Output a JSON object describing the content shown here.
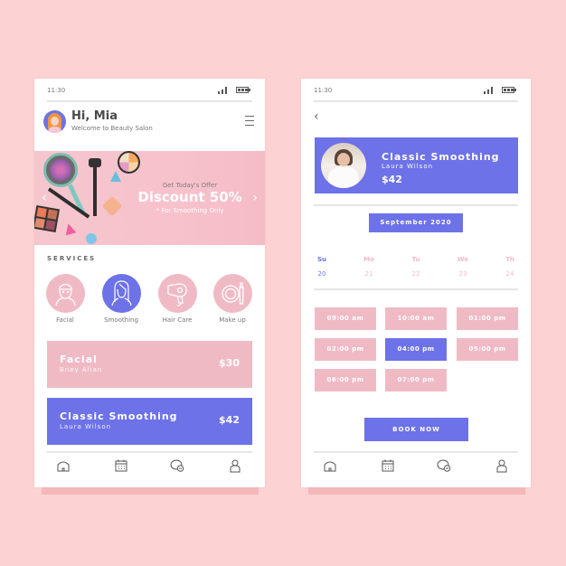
{
  "colors": {
    "background": "#fcd2d3",
    "accent_blue": "#6d72e8",
    "accent_pink": "#f0bac5"
  },
  "screen1": {
    "status": {
      "time": "11:30"
    },
    "header": {
      "greeting": "Hi, Mia",
      "subtitle": "Welcome to Beauty Salon",
      "avatar_icon": "user-avatar",
      "menu_icon": "hamburger-menu-icon"
    },
    "banner": {
      "subtitle": "Get Today's Offer",
      "headline": "Discount 50%",
      "note": "* For Smoothing Only",
      "prev_icon": "‹",
      "next_icon": "›"
    },
    "services": {
      "title": "SERVICES",
      "items": [
        {
          "label": "Facial",
          "icon": "facial-icon",
          "active": false
        },
        {
          "label": "Smoothing",
          "icon": "smoothing-icon",
          "active": true
        },
        {
          "label": "Hair Care",
          "icon": "hair-dryer-icon",
          "active": false
        },
        {
          "label": "Make up",
          "icon": "makeup-icon",
          "active": false
        }
      ]
    },
    "cards": [
      {
        "title": "Facial",
        "stylist": "Bney Alian",
        "price": "$30",
        "color": "pink"
      },
      {
        "title": "Classic Smoothing",
        "stylist": "Laura Wilson",
        "price": "$42",
        "color": "blue"
      }
    ],
    "nav": [
      "home-icon",
      "calendar-icon",
      "chat-icon",
      "profile-icon"
    ]
  },
  "screen2": {
    "status": {
      "time": "11:30"
    },
    "back_icon": "‹",
    "detail": {
      "title": "Classic Smoothing",
      "stylist": "Laura Wilson",
      "price": "$42"
    },
    "month": "September 2020",
    "days": [
      {
        "name": "Su",
        "date": "20",
        "active": true
      },
      {
        "name": "Mo",
        "date": "21",
        "active": false
      },
      {
        "name": "Tu",
        "date": "22",
        "active": false
      },
      {
        "name": "We",
        "date": "23",
        "active": false
      },
      {
        "name": "Th",
        "date": "24",
        "active": false
      }
    ],
    "slots": [
      {
        "time": "09:00 am",
        "active": false
      },
      {
        "time": "10:00 am",
        "active": false
      },
      {
        "time": "01:00 pm",
        "active": false
      },
      {
        "time": "02:00 pm",
        "active": false
      },
      {
        "time": "04:00 pm",
        "active": true
      },
      {
        "time": "05:00 pm",
        "active": false
      },
      {
        "time": "06:00 pm",
        "active": false
      },
      {
        "time": "07:00 pm",
        "active": false
      }
    ],
    "book_button": "BOOK NOW",
    "nav": [
      "home-icon",
      "calendar-icon",
      "chat-icon",
      "profile-icon"
    ]
  }
}
